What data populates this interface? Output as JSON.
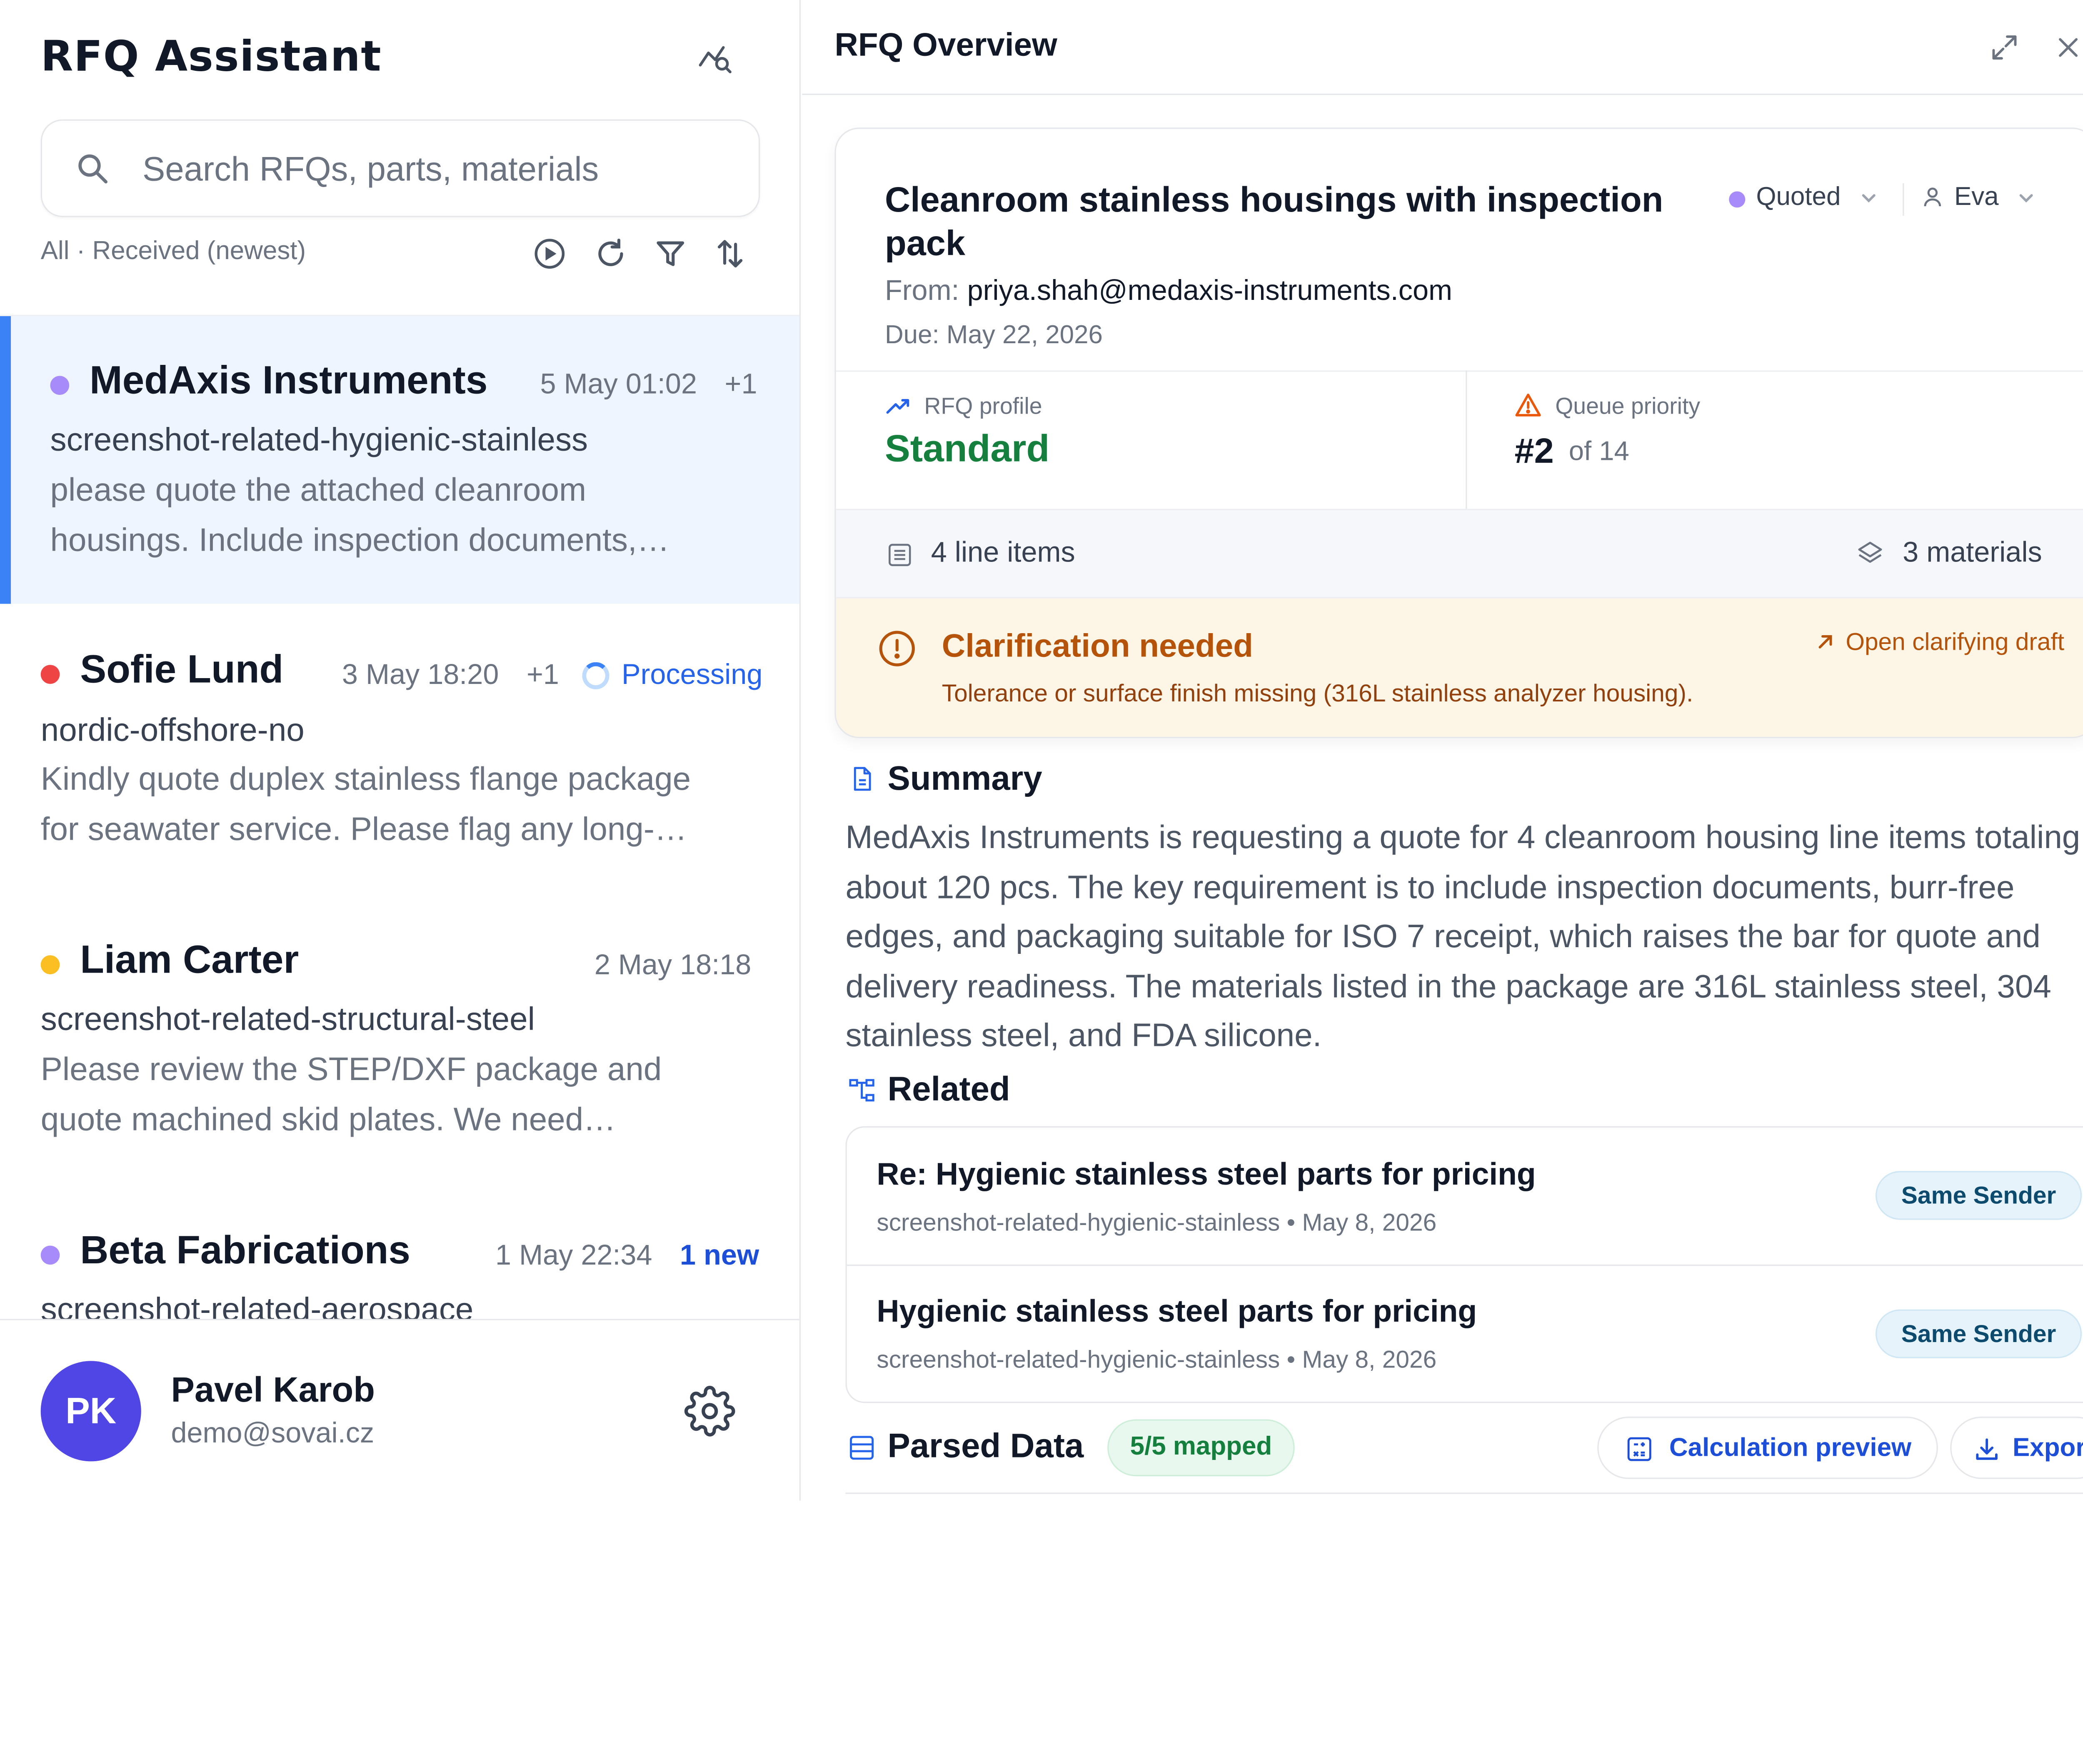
{
  "app": {
    "title": "RFQ Assistant"
  },
  "search": {
    "placeholder": "Search RFQs, parts, materials",
    "value": ""
  },
  "list_filter": {
    "label": "All · Received (newest)"
  },
  "rfq_list": [
    {
      "sender": "MedAxis Instruments",
      "date": "5 May 01:02",
      "extra": "+1",
      "company": "screenshot-related-hygienic-stainless",
      "preview_line1": "please quote the attached cleanroom",
      "preview_line2": "housings. Include inspection documents,…",
      "dot_color": "#a78bfa",
      "selected": true
    },
    {
      "sender": "Sofie Lund",
      "date": "3 May 18:20",
      "extra": "+1",
      "status": "Processing",
      "company": "nordic-offshore-no",
      "preview_line1": "Kindly quote duplex stainless flange package",
      "preview_line2": "for seawater service. Please flag any long-…",
      "dot_color": "#ef4444"
    },
    {
      "sender": "Liam Carter",
      "date": "2 May 18:18",
      "company": "screenshot-related-structural-steel",
      "preview_line1": "Please review the STEP/DXF package and",
      "preview_line2": "quote machined skid plates. We need…",
      "dot_color": "#fbbf24"
    },
    {
      "sender": "Beta Fabrications",
      "date": "1 May 22:34",
      "badge": "1 new",
      "company": "screenshot-related-aerospace",
      "dot_color": "#a78bfa"
    }
  ],
  "user": {
    "initials": "PK",
    "name": "Pavel Karob",
    "email": "demo@sovai.cz"
  },
  "overview": {
    "panel_title": "RFQ Overview",
    "title": "Cleanroom stainless housings with inspection pack",
    "status": "Quoted",
    "status_color": "#a78bfa",
    "assignee": "Eva",
    "from_label": "From:",
    "from_email": "priya.shah@medaxis-instruments.com",
    "due": "Due: May 22, 2026",
    "profile_label": "RFQ profile",
    "profile_value": "Standard",
    "priority_label": "Queue priority",
    "priority_rank": "#2",
    "priority_of": "of 14",
    "line_items": "4 line items",
    "materials": "3 materials",
    "clarification": {
      "title": "Clarification needed",
      "description": "Tolerance or surface finish missing (316L stainless analyzer housing).",
      "link": "Open clarifying draft"
    }
  },
  "summary": {
    "heading": "Summary",
    "text": "MedAxis Instruments is requesting a quote for 4 cleanroom housing line items totaling about 120 pcs. The key requirement is to include inspection documents, burr-free edges, and packaging suitable for ISO 7 receipt, which raises the bar for quote and delivery readiness. The materials listed in the package are 316L stainless steel, 304 stainless steel, and FDA silicone."
  },
  "related": {
    "heading": "Related",
    "items": [
      {
        "title": "Re: Hygienic stainless steel parts for pricing",
        "subtitle": "screenshot-related-hygienic-stainless • May 8, 2026",
        "badge": "Same Sender"
      },
      {
        "title": "Hygienic stainless steel parts for pricing",
        "subtitle": "screenshot-related-hygienic-stainless • May 8, 2026",
        "badge": "Same Sender"
      }
    ]
  },
  "parsed": {
    "heading": "Parsed Data",
    "mapped": "5/5 mapped",
    "calc_button": "Calculation preview",
    "export_button": "Export"
  },
  "colors": {
    "accent": "#3b82f6",
    "link_blue": "#1d4ed8",
    "green": "#15803d",
    "warning": "#b45309",
    "avatar": "#4f46e5"
  }
}
